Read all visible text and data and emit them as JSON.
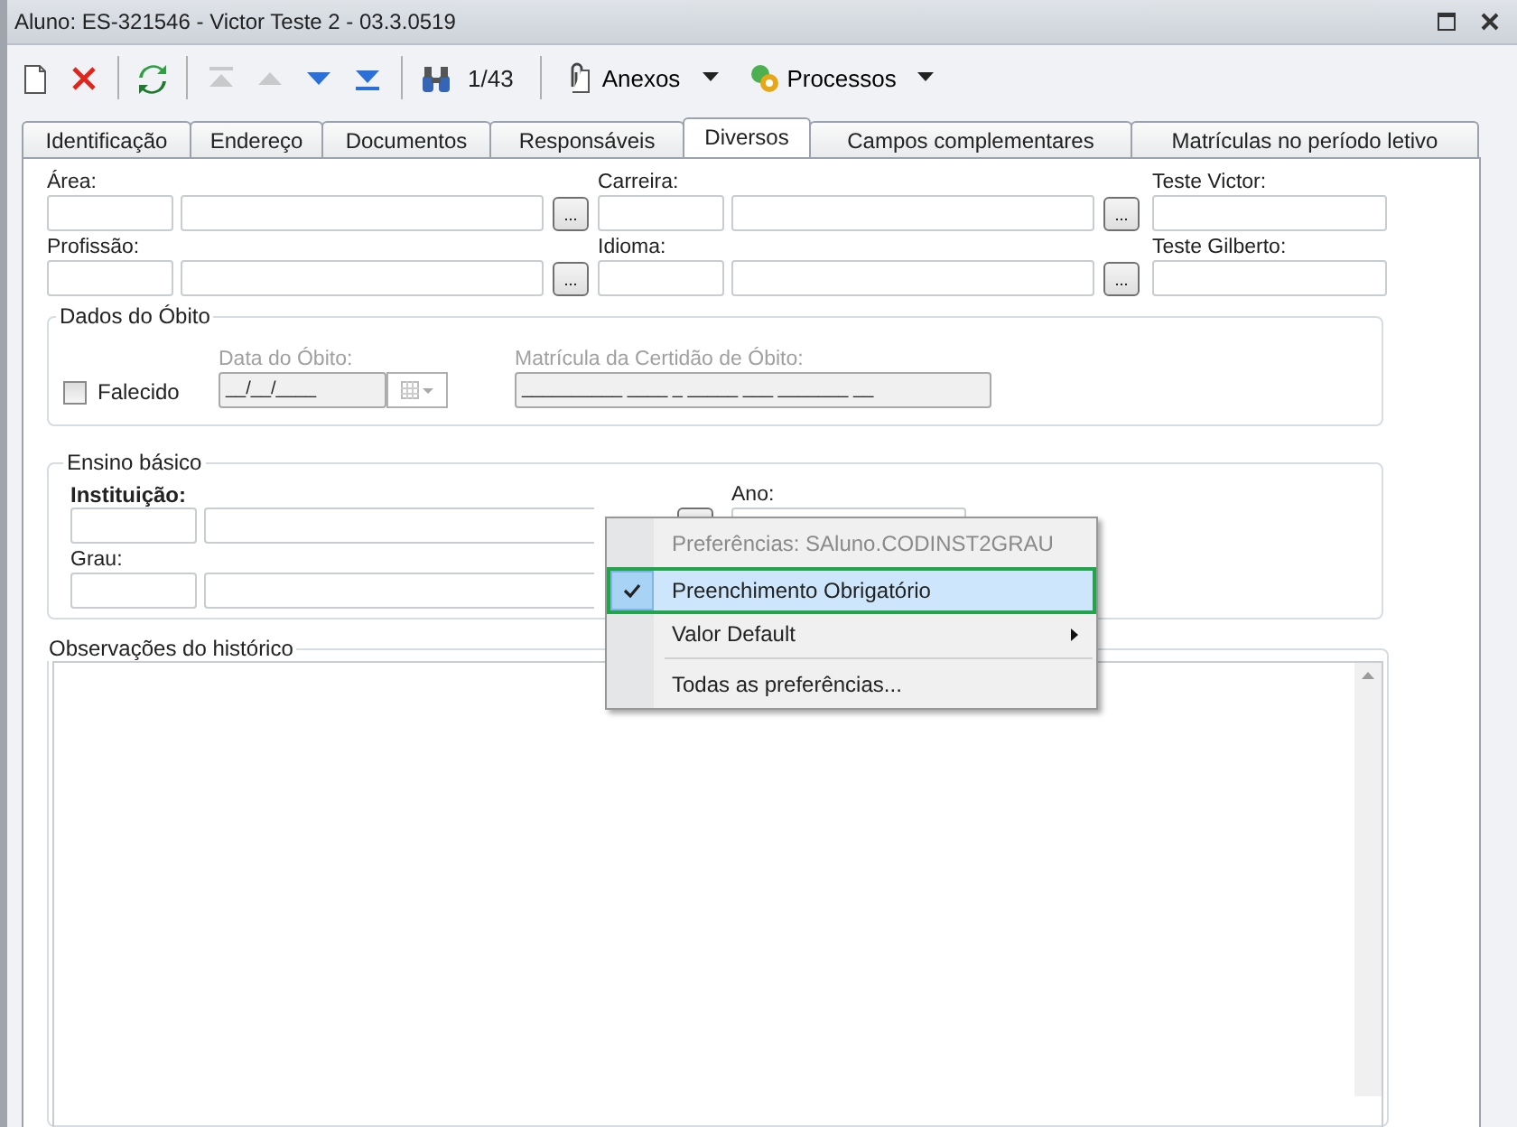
{
  "window": {
    "title": "Aluno: ES-321546 - Victor Teste 2 - 03.3.0519",
    "controls": [
      {
        "kind": "restore"
      },
      {
        "kind": "close"
      }
    ]
  },
  "toolbar": {
    "items": [
      {
        "kind": "new",
        "disabled": false
      },
      {
        "kind": "delete",
        "disabled": false
      },
      {
        "kind": "separator"
      },
      {
        "kind": "refresh",
        "disabled": false
      },
      {
        "kind": "separator"
      },
      {
        "kind": "first",
        "disabled": true
      },
      {
        "kind": "prev",
        "disabled": true
      },
      {
        "kind": "next",
        "disabled": false
      },
      {
        "kind": "last",
        "disabled": false
      },
      {
        "kind": "separator"
      },
      {
        "kind": "find",
        "disabled": false
      }
    ],
    "record_counter": "1/43",
    "menus": [
      {
        "label": "Anexos",
        "kind": "attach"
      },
      {
        "label": "Processos",
        "kind": "process"
      }
    ]
  },
  "tabs": [
    {
      "label": "Identificação",
      "selected": false
    },
    {
      "label": "Endereço",
      "selected": false
    },
    {
      "label": "Documentos",
      "selected": false
    },
    {
      "label": "Responsáveis",
      "selected": false
    },
    {
      "label": "Diversos",
      "selected": true
    },
    {
      "label": "Campos complementares",
      "selected": false
    },
    {
      "label": "Matrículas no período letivo",
      "selected": false
    }
  ],
  "form_rows": [
    [
      {
        "kind": "lookup",
        "label": "Área:",
        "button": "..."
      },
      {
        "kind": "lookup",
        "label": "Carreira:",
        "button": "..."
      },
      {
        "kind": "text",
        "label": "Teste Victor:"
      }
    ],
    [
      {
        "kind": "lookup",
        "label": "Profissão:",
        "button": "..."
      },
      {
        "kind": "lookup",
        "label": "Idioma:",
        "button": "..."
      },
      {
        "kind": "text",
        "label": "Teste Gilberto:"
      }
    ]
  ],
  "obito": {
    "title": "Dados do Óbito",
    "falecido": {
      "label": "Falecido",
      "checked": false
    },
    "date": {
      "label": "Data do Óbito:",
      "value": "__/__/____",
      "disabled": true
    },
    "matricula": {
      "label": "Matrícula da Certidão de Óbito:",
      "value": "__________ ____ _ _____ ___ _______ __",
      "disabled": true
    }
  },
  "ensino": {
    "title": "Ensino básico",
    "instituicao": {
      "label": "Instituição:"
    },
    "ano": {
      "label": "Ano:"
    },
    "grau": {
      "label": "Grau:"
    }
  },
  "observacoes": {
    "title": "Observações do histórico"
  },
  "context_menu": {
    "items": [
      {
        "kind": "header",
        "label": "Preferências: SAluno.CODINST2GRAU",
        "checked": false,
        "selected": false
      },
      {
        "kind": "check",
        "label": "Preenchimento Obrigatório",
        "checked": true,
        "selected": true
      },
      {
        "kind": "submenu",
        "label": "Valor Default",
        "checked": false,
        "selected": false
      },
      {
        "kind": "separator"
      },
      {
        "kind": "action",
        "label": "Todas as preferências...",
        "checked": false,
        "selected": false
      }
    ]
  }
}
